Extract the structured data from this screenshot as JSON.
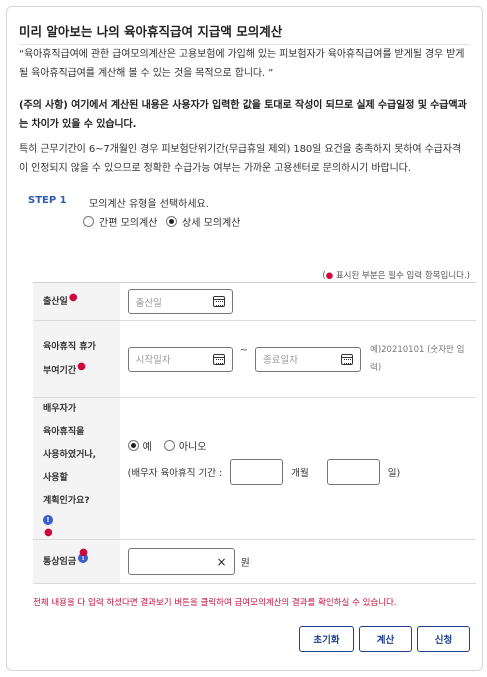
{
  "title": "미리 알아보는 나의 육아휴직급여 지급액 모의계산",
  "intro": {
    "p1_line1": "“육아휴직급여에 관한 급여모의계산은 고용보험에 가입해 있는 피보험자가 육아휴직급여를 받게될 경우 받게",
    "p1_line2": "될 육아휴직급여를 계산해 볼 수 있는 것을 목적으로 합니다. ”",
    "p2_line1": "(주의 사항) 여기에서 계산된 내용은 사용자가 입력한 값을 토대로 작성이 되므로 실제 수급일정 및 수급액과",
    "p2_line2": "는 차이가 있을 수 있습니다.",
    "p3_line1": "특히 근무기간이 6~7개월인 경우 피보험단위기간(무급휴일 제외) 180일 요건을 충족하지 못하여 수급자격",
    "p3_line2": "이 인정되지 않을 수 있으므로 정확한 수급가능 여부는 가까운 고용센터로 문의하시기 바랍니다."
  },
  "step": {
    "label": "STEP 1",
    "question": "모의계산 유형을 선택하세요.",
    "options": [
      "간편 모의계산",
      "상세 모의계산"
    ],
    "selected": "상세 모의계산"
  },
  "required_note_prefix": "(",
  "required_note_dot": "●",
  "required_note_text": " 표시된 부분은 필수 입력 항목입니다.)",
  "form": {
    "birth_label": "출산일",
    "birth_placeholder": "출산일",
    "leave_label_1": "육아휴직 휴가",
    "leave_label_2": "부여기간",
    "start_placeholder": "시작일자",
    "end_placeholder": "종료일자",
    "tilde": "~",
    "date_hint_1": "예)20210101 (숫자만 입",
    "date_hint_2": "력)",
    "spouse_label_1": "배우자가",
    "spouse_label_2": "육아휴직을",
    "spouse_label_3": "사용하였거나,",
    "spouse_label_4": "사용할",
    "spouse_label_5": "계획인가요?",
    "yes": "예",
    "no": "아니오",
    "spouse_selected": "예",
    "spouse_period_label": "(배우자 육아휴직 기간 :",
    "months_unit": "개월",
    "days_unit": "일)",
    "wage_label": "통상임금",
    "wage_value": "",
    "wage_clear": "×",
    "wage_unit": "원"
  },
  "notice": "전체 내용을 다 입력 하셨다면 결과보기 버튼을 클릭하여 급여모의계산의 결과를 확인하실 수 있습니다.",
  "buttons": {
    "reset": "초기화",
    "calculate": "계산",
    "apply": "신청"
  },
  "colors": {
    "accent": "#1f3f8f",
    "step": "#2e5bb7",
    "required": "#d0043c",
    "notice": "#c5123e"
  }
}
